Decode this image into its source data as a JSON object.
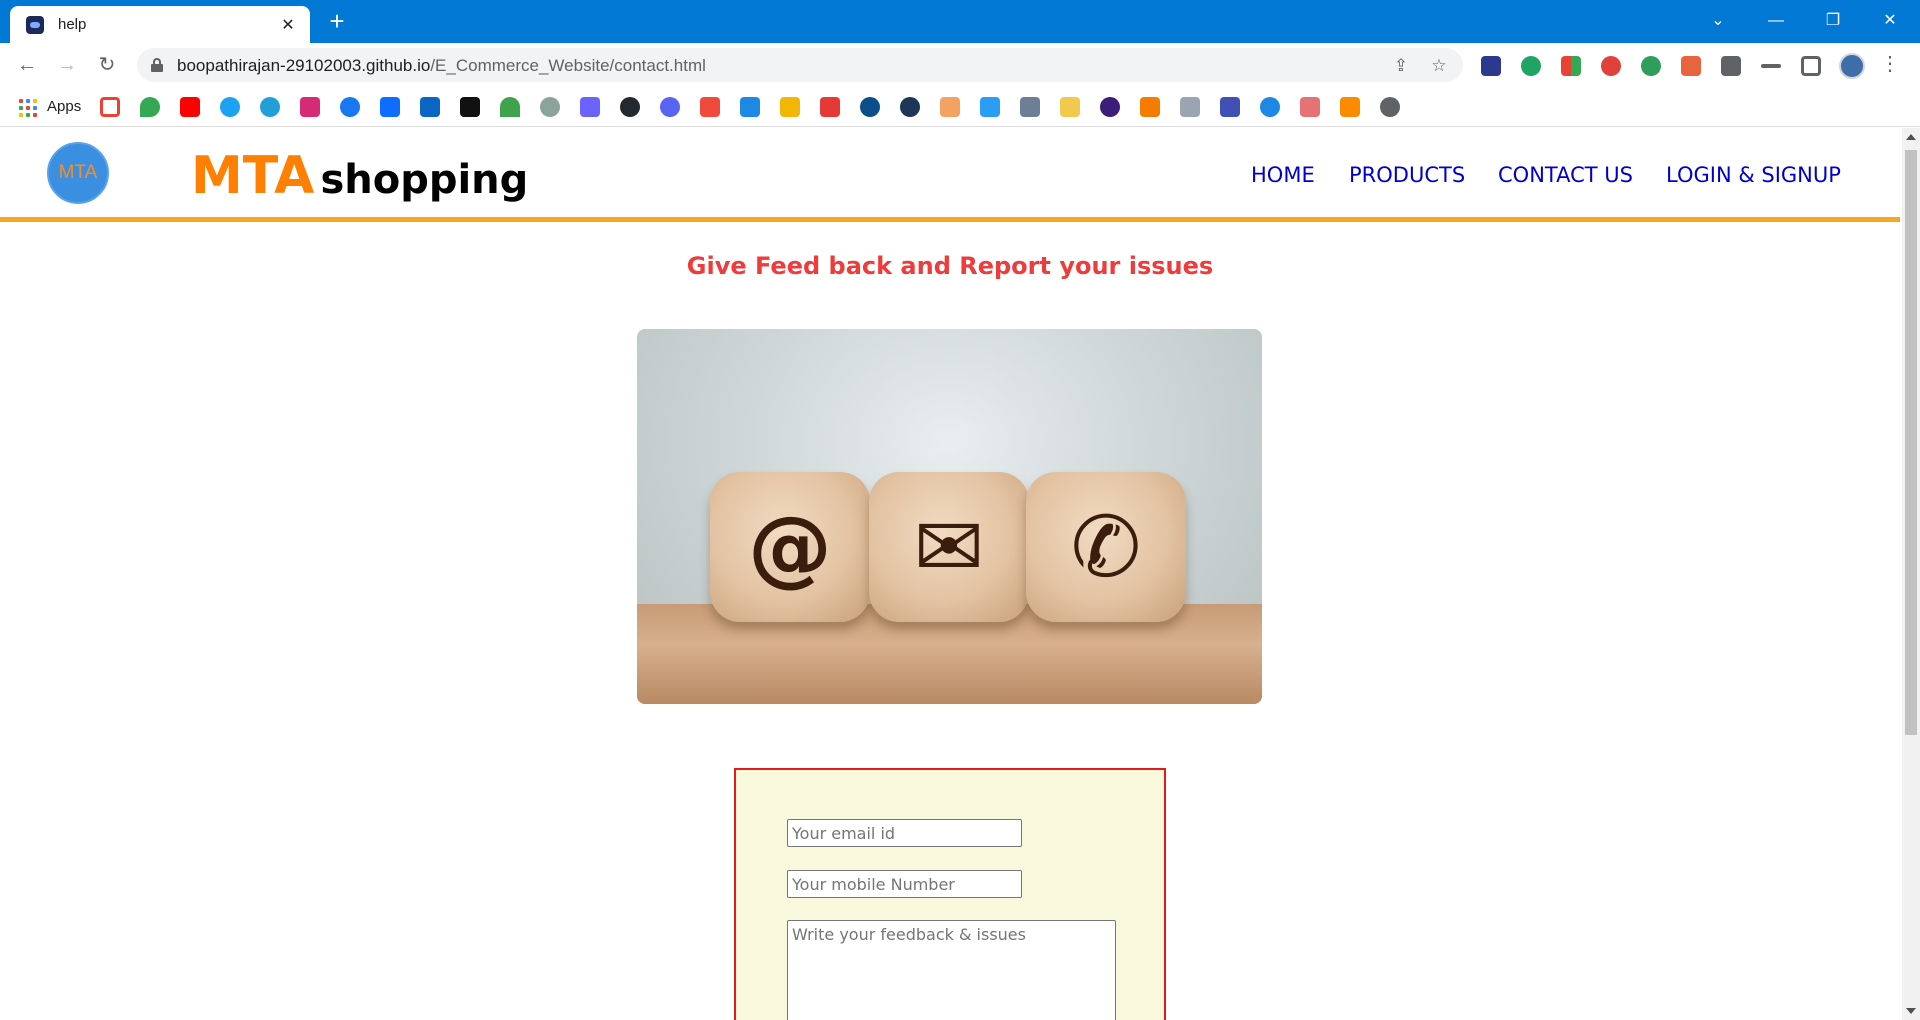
{
  "browser": {
    "tab_title": "help",
    "tab_close": "✕",
    "new_tab": "+",
    "url_host": "boopathirajan-29102003.github.io",
    "url_path": "/E_Commerce_Website/contact.html",
    "bookmarks_apps_label": "Apps"
  },
  "site": {
    "logo_text": "MTA",
    "brand_primary": "MTA",
    "brand_secondary": "shopping",
    "nav": [
      "HOME",
      "PRODUCTS",
      "CONTACT US",
      "LOGIN & SIGNUP"
    ]
  },
  "content": {
    "heading": "Give Feed back and Report your issues",
    "image_symbols": [
      "@",
      "✉",
      "✆"
    ]
  },
  "form": {
    "email_placeholder": "Your email id",
    "mobile_placeholder": "Your mobile Number",
    "feedback_placeholder": "Write your feedback & issues"
  },
  "colors": {
    "chrome_blue": "#0078d4",
    "brand_orange": "#ff7f00",
    "header_rule": "#f5a623",
    "nav_link": "#0000cc",
    "heading_red": "#ee3b3b",
    "form_border": "#e31b1b",
    "form_bg": "#f7f8dc"
  }
}
